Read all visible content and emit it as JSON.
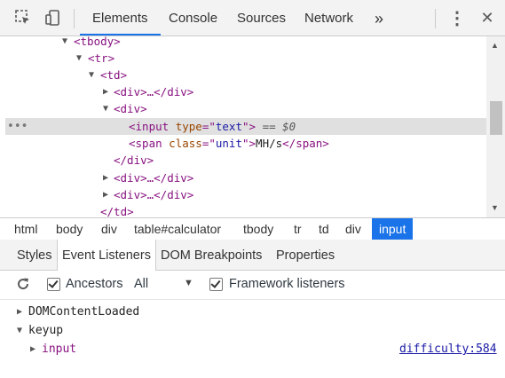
{
  "toolbar": {
    "tabs": [
      "Elements",
      "Console",
      "Sources",
      "Network"
    ],
    "more_icon": "»",
    "menu_icon": "⋮",
    "close_icon": "✕"
  },
  "tree": {
    "tbody_open": "<tbody>",
    "tr_open": "<tr>",
    "td_open": "<td>",
    "div_collapsed_1": "<div>…</div>",
    "div_open": "<div>",
    "input_lt": "<",
    "input_tag": "input",
    "input_attr": "type",
    "input_eq": "=\"",
    "input_val": "text",
    "input_end": "\">",
    "selected_marker": "== $0",
    "span_open_lt": "<span",
    "span_attr": "class",
    "span_val": "unit",
    "span_close_bracket": ">",
    "span_text": "MH/s",
    "span_close": "</span>",
    "div_close": "</div>",
    "div_collapsed_2": "<div>…</div>",
    "div_collapsed_3": "<div>…</div>",
    "td_close": "</td>",
    "dots": "•••"
  },
  "breadcrumb": [
    "html",
    "body",
    "div",
    "table#calculator",
    "tbody",
    "tr",
    "td",
    "div",
    "input"
  ],
  "subtabs": [
    "Styles",
    "Event Listeners",
    "DOM Breakpoints",
    "Properties"
  ],
  "filter": {
    "ancestors_label": "Ancestors",
    "scope_value": "All",
    "framework_label": "Framework listeners"
  },
  "listeners": {
    "items": [
      "DOMContentLoaded",
      "keyup"
    ],
    "child": "input",
    "source_link": "difficulty:584"
  },
  "colors": {
    "accent": "#1a73e8",
    "tag": "#881280",
    "attr": "#994500",
    "value": "#1a1aa6"
  }
}
